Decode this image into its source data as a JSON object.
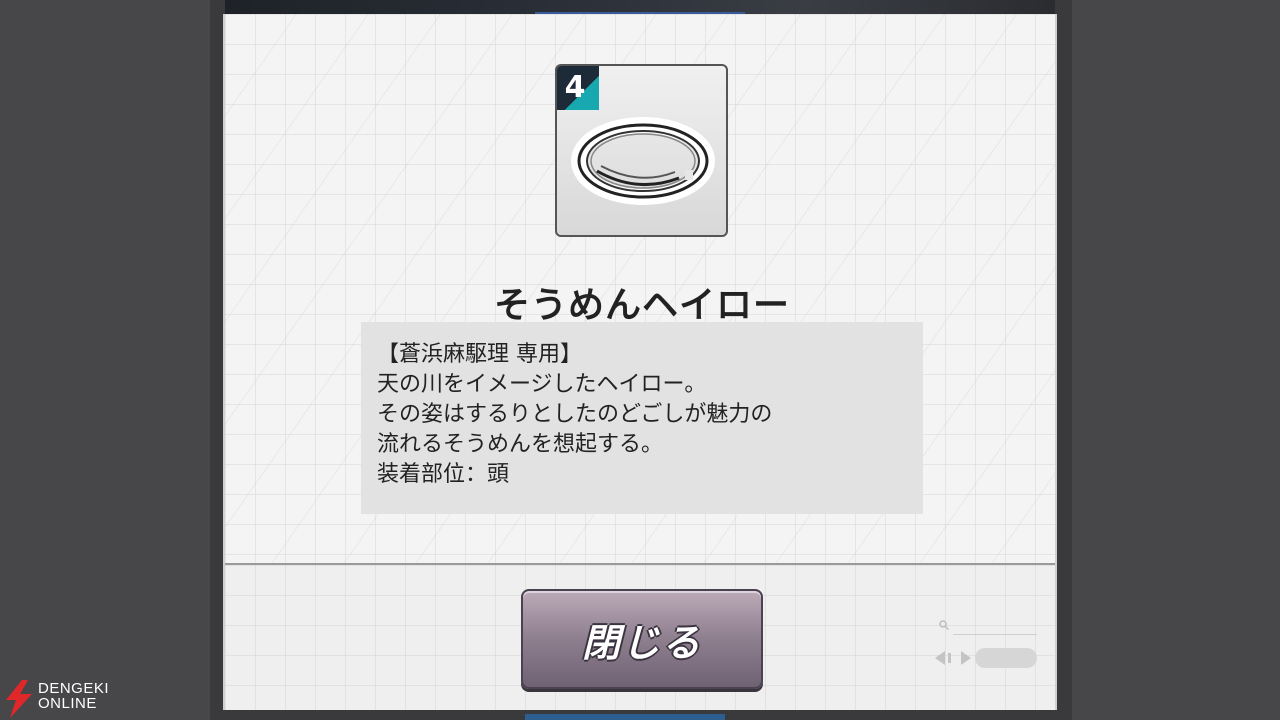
{
  "item": {
    "rarity": "4",
    "name": "そうめんヘイロー",
    "description_lines": [
      "【蒼浜麻駆理 専用】",
      "天の川をイメージしたヘイロー。",
      "その姿はするりとしたのどごしが魅力の",
      "流れるそうめんを想起する。",
      "装着部位：頭"
    ]
  },
  "buttons": {
    "close_label": "閉じる"
  },
  "watermark": {
    "line1": "DENGEKI",
    "line2": "ONLINE"
  },
  "colors": {
    "rarity_accent": "#17a8b0",
    "button_gradient_top": "#bcaab8",
    "button_gradient_bottom": "#6f6272"
  },
  "icons": {
    "item_image": "ring-halo-icon",
    "search": "search-icon",
    "nav": "left-right-arrow-icon"
  }
}
